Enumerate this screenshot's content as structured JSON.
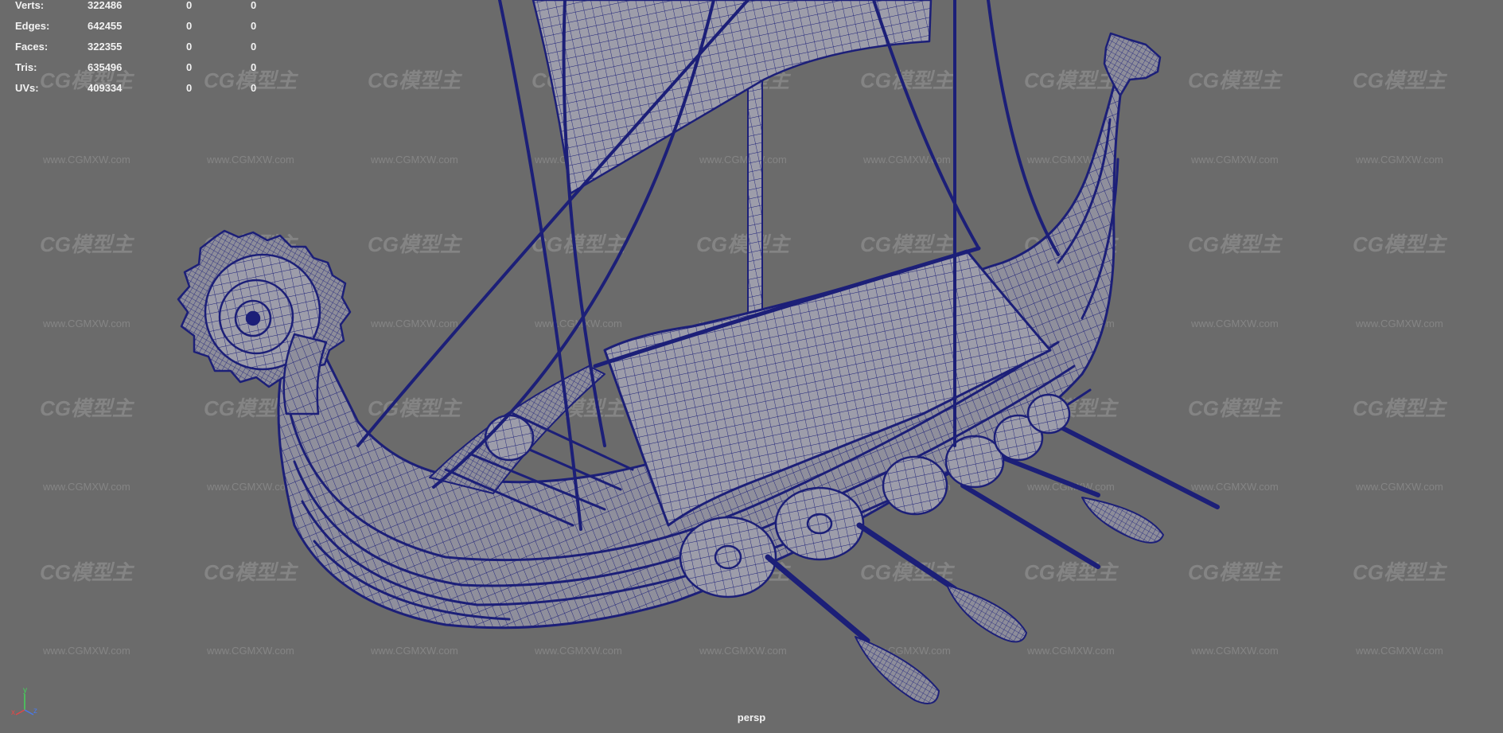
{
  "hud": {
    "rows": [
      {
        "label": "Verts:",
        "total": "322486",
        "selected": "0",
        "extra": "0"
      },
      {
        "label": "Edges:",
        "total": "642455",
        "selected": "0",
        "extra": "0"
      },
      {
        "label": "Faces:",
        "total": "322355",
        "selected": "0",
        "extra": "0"
      },
      {
        "label": "Tris:",
        "total": "635496",
        "selected": "0",
        "extra": "0"
      },
      {
        "label": "UVs:",
        "total": "409334",
        "selected": "0",
        "extra": "0"
      }
    ]
  },
  "camera_label": "persp",
  "axis": {
    "y": "y",
    "x": "x",
    "z": "z"
  },
  "watermark": {
    "logo": "CG模型主",
    "url": "www.CGMXW.com"
  },
  "colors": {
    "background": "#6b6b6b",
    "wireframe": "#1c1f78",
    "fill": "#9a9aa6",
    "hud_text": "#f2f2f2"
  }
}
